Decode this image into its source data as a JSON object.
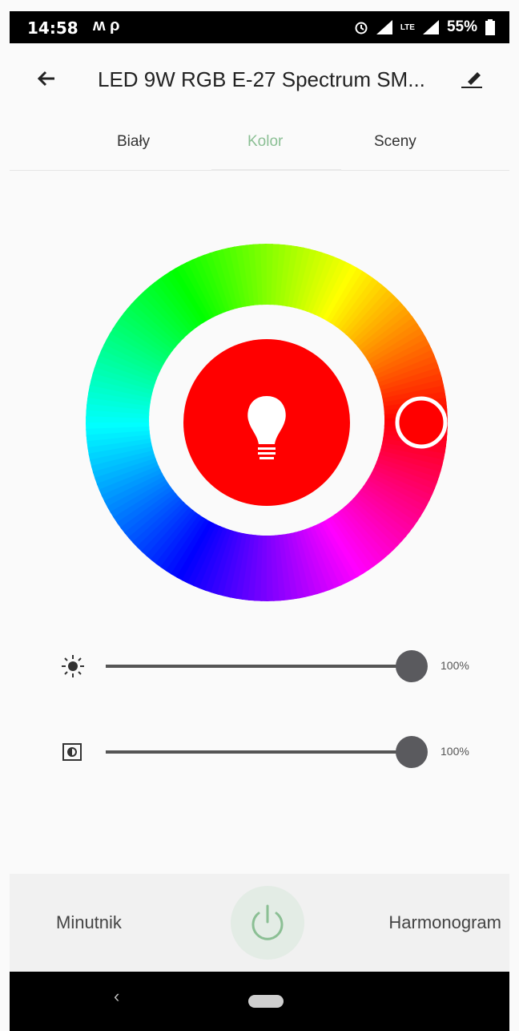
{
  "status_bar": {
    "time": "14:58",
    "left_icons": "ʍ ρ",
    "lte": "LTE",
    "battery": "55%"
  },
  "app_bar": {
    "title": "LED 9W RGB E-27 Spectrum SM..."
  },
  "tabs": [
    {
      "label": "Biały"
    },
    {
      "label": "Kolor"
    },
    {
      "label": "Sceny"
    }
  ],
  "active_tab": "Kolor",
  "color": {
    "selected_hex": "#ff0000",
    "accent": "#8bbf94"
  },
  "sliders": [
    {
      "icon": "brightness-icon",
      "value_label": "100%",
      "value": 1.0
    },
    {
      "icon": "contrast-icon",
      "value_label": "100%",
      "value": 1.0
    }
  ],
  "bottom": {
    "left_label": "Minutnik",
    "right_label": "Harmonogram"
  }
}
